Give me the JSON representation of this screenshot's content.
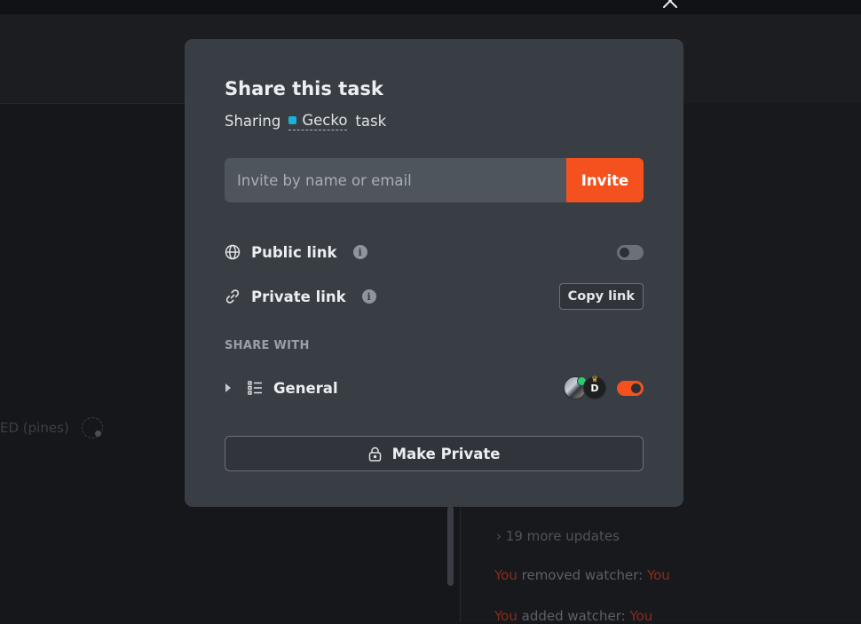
{
  "modal": {
    "title": "Share this task",
    "subtitle_prefix": "Sharing",
    "task_name": "Gecko",
    "subtitle_suffix": "task",
    "task_color": "#1ab2d6",
    "invite": {
      "placeholder": "Invite by name or email",
      "button_label": "Invite"
    },
    "public_link": {
      "label": "Public link",
      "info_icon": "i",
      "enabled": false
    },
    "private_link": {
      "label": "Private link",
      "info_icon": "i",
      "copy_label": "Copy link"
    },
    "share_with_heading": "SHARE WITH",
    "general": {
      "label": "General",
      "avatar_2_initials": "D",
      "enabled": true
    },
    "make_private_label": "Make Private"
  },
  "background": {
    "assignee_text": "ED (pines)",
    "more_updates": "19 more updates",
    "activity": [
      {
        "actor": "You",
        "text": " removed watcher: ",
        "target": "You"
      },
      {
        "actor": "You",
        "text": " added watcher: ",
        "target": "You"
      }
    ]
  },
  "colors": {
    "accent": "#f4511e",
    "modal_bg": "#393e45",
    "online": "#2ecc71"
  }
}
